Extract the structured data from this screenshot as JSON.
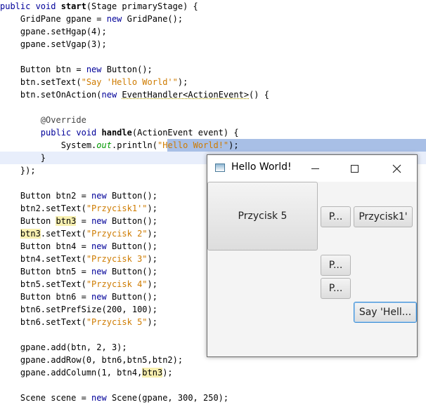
{
  "editor": {
    "lines": [
      {
        "p": [
          {
            "t": "public void ",
            "c": "kwn"
          },
          {
            "t": "start",
            "c": "bold"
          },
          {
            "t": "(Stage primaryStage) {"
          }
        ]
      },
      {
        "p": [
          {
            "t": "    GridPane gpane = "
          },
          {
            "t": "new",
            "c": "kwn"
          },
          {
            "t": " GridPane();"
          }
        ]
      },
      {
        "p": [
          {
            "t": "    gpane.setHgap(4);"
          }
        ]
      },
      {
        "p": [
          {
            "t": "    gpane.setVgap(3);"
          }
        ]
      },
      {
        "p": [
          {
            "t": ""
          }
        ]
      },
      {
        "p": [
          {
            "t": "    Button btn = "
          },
          {
            "t": "new",
            "c": "kwn"
          },
          {
            "t": " Button();"
          }
        ]
      },
      {
        "p": [
          {
            "t": "    btn.setText("
          },
          {
            "t": "\"Say 'Hello World'\"",
            "c": "str"
          },
          {
            "t": ");"
          }
        ]
      },
      {
        "p": [
          {
            "t": "    btn.setOnAction("
          },
          {
            "t": "new",
            "c": "kwn"
          },
          {
            "t": " "
          },
          {
            "t": "EventHandler<ActionEvent>",
            "c": "dash"
          },
          {
            "t": "() {"
          }
        ]
      },
      {
        "p": [
          {
            "t": ""
          }
        ]
      },
      {
        "p": [
          {
            "t": "        @Override",
            "c": "ann"
          }
        ]
      },
      {
        "p": [
          {
            "t": "        "
          },
          {
            "t": "public void ",
            "c": "kwn"
          },
          {
            "t": "handle",
            "c": "bold"
          },
          {
            "t": "(ActionEvent event) {"
          }
        ]
      },
      {
        "p": [
          {
            "t": "            System."
          },
          {
            "t": "out",
            "c": "fld"
          },
          {
            "t": ".println("
          },
          {
            "t": "\"Hello World!\"",
            "c": "str"
          },
          {
            "t": ");"
          }
        ]
      },
      {
        "p": [
          {
            "t": "        }"
          }
        ]
      },
      {
        "p": [
          {
            "t": "    });"
          }
        ]
      },
      {
        "p": [
          {
            "t": ""
          }
        ]
      },
      {
        "p": [
          {
            "t": "    Button btn2 = "
          },
          {
            "t": "new",
            "c": "kwn"
          },
          {
            "t": " Button();"
          }
        ]
      },
      {
        "p": [
          {
            "t": "    btn2.setText("
          },
          {
            "t": "\"Przycisk1'\"",
            "c": "str"
          },
          {
            "t": ");"
          }
        ]
      },
      {
        "p": [
          {
            "t": "    Button "
          },
          {
            "t": "btn3",
            "c": "occ"
          },
          {
            "t": " = "
          },
          {
            "t": "new",
            "c": "kwn"
          },
          {
            "t": " Button();"
          }
        ]
      },
      {
        "p": [
          {
            "t": "    "
          },
          {
            "t": "btn3",
            "c": "occ"
          },
          {
            "t": ".setText("
          },
          {
            "t": "\"Przycisk 2\"",
            "c": "str"
          },
          {
            "t": ");"
          }
        ]
      },
      {
        "p": [
          {
            "t": "    Button btn4 = "
          },
          {
            "t": "new",
            "c": "kwn"
          },
          {
            "t": " Button();"
          }
        ]
      },
      {
        "p": [
          {
            "t": "    btn4.setText("
          },
          {
            "t": "\"Przycisk 3\"",
            "c": "str"
          },
          {
            "t": ");"
          }
        ]
      },
      {
        "p": [
          {
            "t": "    Button btn5 = "
          },
          {
            "t": "new",
            "c": "kwn"
          },
          {
            "t": " Button();"
          }
        ]
      },
      {
        "p": [
          {
            "t": "    btn5.setText("
          },
          {
            "t": "\"Przycisk 4\"",
            "c": "str"
          },
          {
            "t": ");"
          }
        ]
      },
      {
        "p": [
          {
            "t": "    Button btn6 = "
          },
          {
            "t": "new",
            "c": "kwn"
          },
          {
            "t": " Button();"
          }
        ]
      },
      {
        "p": [
          {
            "t": "    btn6.setPrefSize(200, 100);"
          }
        ]
      },
      {
        "p": [
          {
            "t": "    btn6.setText("
          },
          {
            "t": "\"Przycisk 5\"",
            "c": "str"
          },
          {
            "t": ");"
          }
        ]
      },
      {
        "p": [
          {
            "t": ""
          }
        ]
      },
      {
        "p": [
          {
            "t": "    gpane.add(btn, 2, 3);"
          }
        ]
      },
      {
        "p": [
          {
            "t": "    gpane.addRow(0, btn6,btn5,btn2);"
          }
        ]
      },
      {
        "p": [
          {
            "t": "    gpane.addColumn(1, btn4,"
          },
          {
            "t": "btn3",
            "c": "occ"
          },
          {
            "t": ");"
          }
        ]
      },
      {
        "p": [
          {
            "t": ""
          }
        ]
      },
      {
        "p": [
          {
            "t": "    Scene scene = "
          },
          {
            "t": "new",
            "c": "kwn"
          },
          {
            "t": " Scene(gpane, 300, 250);"
          }
        ]
      }
    ]
  },
  "window": {
    "title": "Hello World!",
    "icon": "java-window-icon",
    "controls": {
      "minimize": "minimize-icon",
      "maximize": "maximize-icon",
      "close": "close-icon"
    }
  },
  "buttons": {
    "btn6_label": "Przycisk 5",
    "btn5_label": "P...",
    "btn2_label": "Przycisk1'",
    "btn4_label": "P...",
    "btn3_label": "P...",
    "btn_label": "Say 'Hell..."
  }
}
